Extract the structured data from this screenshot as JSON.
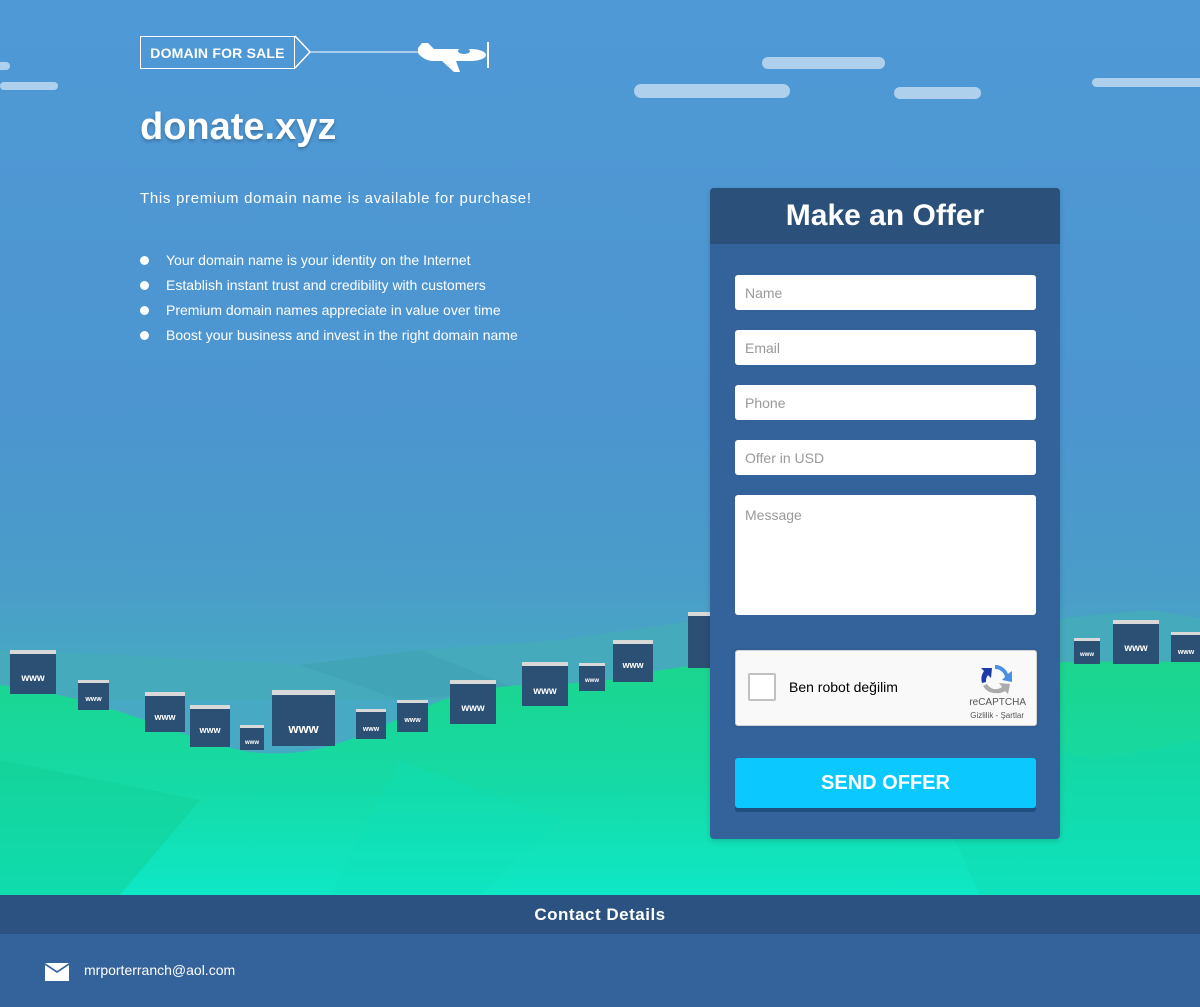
{
  "banner": {
    "label": "DOMAIN FOR SALE",
    "plane_icon": "airplane-icon"
  },
  "domain": {
    "name": "donate.xyz"
  },
  "intro": {
    "text": "This premium domain name is available for purchase!"
  },
  "features": [
    "Your domain name is your identity on the Internet",
    "Establish instant trust and credibility with customers",
    "Premium domain names appreciate in value over time",
    "Boost your business and invest in the right domain name"
  ],
  "billboard_label": "www",
  "offer_form": {
    "title": "Make an Offer",
    "name_placeholder": "Name",
    "email_placeholder": "Email",
    "phone_placeholder": "Phone",
    "offer_placeholder": "Offer in USD",
    "message_placeholder": "Message",
    "captcha": {
      "label": "Ben robot değilim",
      "brand": "reCAPTCHA",
      "links": "Gizlilik - Şartlar"
    },
    "submit_label": "SEND OFFER"
  },
  "contact": {
    "title": "Contact Details",
    "email": "mrporterranch@aol.com",
    "email_icon": "envelope-icon"
  },
  "colors": {
    "sky": "#4f98d3",
    "panel": "#34629a",
    "panel_header": "#2b5079",
    "button": "#0bc8ff",
    "hills": "#1fd99a"
  }
}
